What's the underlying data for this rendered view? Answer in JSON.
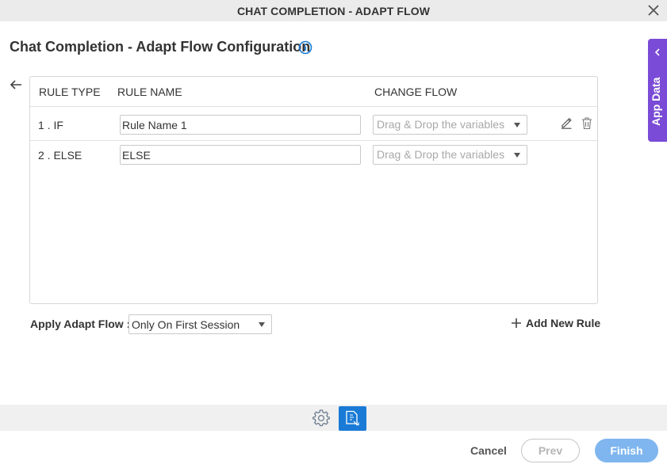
{
  "window": {
    "title": "CHAT COMPLETION - ADAPT FLOW"
  },
  "page": {
    "title": "Chat Completion - Adapt Flow Configuration"
  },
  "side_tab": {
    "label": "App Data"
  },
  "grid": {
    "headers": {
      "rule_type": "RULE TYPE",
      "rule_name": "RULE NAME",
      "change_flow": "CHANGE FLOW"
    },
    "rows": [
      {
        "rule_type": "1 . IF",
        "rule_name": "Rule Name 1",
        "change_flow_placeholder": "Drag & Drop the variables"
      },
      {
        "rule_type": "2 . ELSE",
        "rule_name": "ELSE",
        "change_flow_placeholder": "Drag & Drop the variables"
      }
    ]
  },
  "apply": {
    "label": "Apply Adapt Flow :",
    "value": "Only On First Session"
  },
  "add_rule_label": "Add New Rule",
  "footer": {
    "cancel": "Cancel",
    "prev": "Prev",
    "finish": "Finish"
  },
  "colors": {
    "accent": "#1a7bd6",
    "side_tab": "#7a4bd6",
    "finish_bg": "#7fb6ef"
  }
}
